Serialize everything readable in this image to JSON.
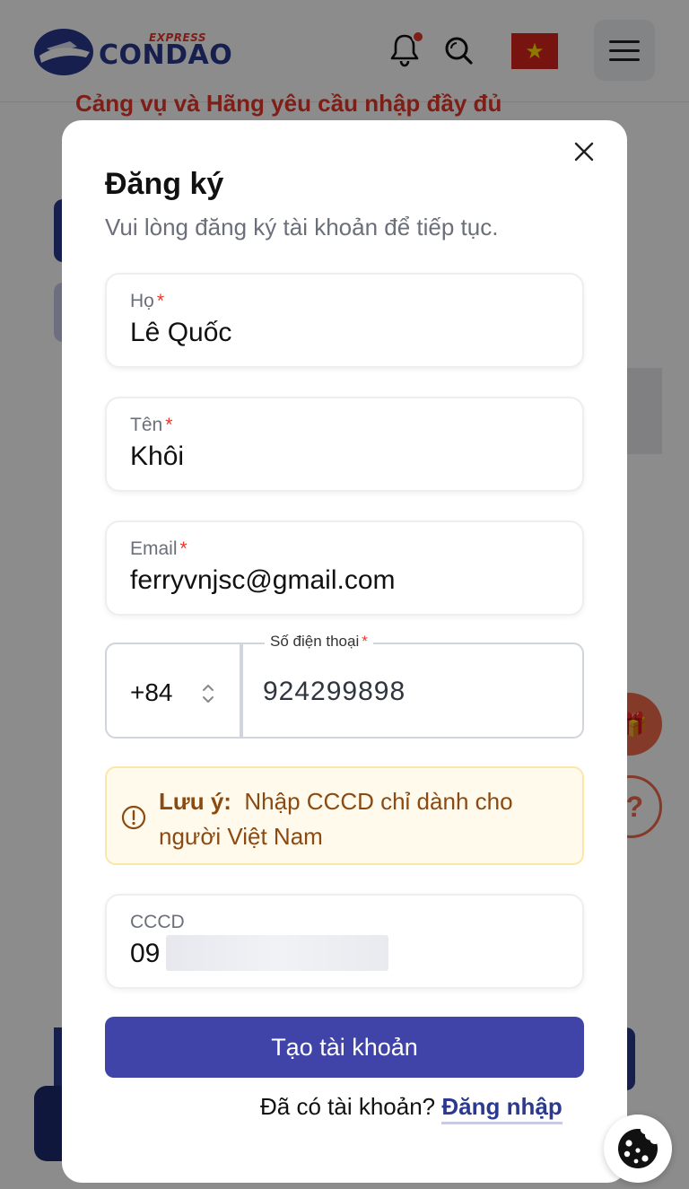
{
  "header": {
    "logo_text": "CONDAO",
    "logo_express": "EXPRESS",
    "flag_icon": "vn-flag-icon",
    "brand_blue": "#2b3a8f",
    "brand_red": "#e5382a"
  },
  "background": {
    "notice_text": "Cảng vụ và Hãng yêu cầu nhập đầy đủ"
  },
  "modal": {
    "title": "Đăng ký",
    "subtitle": "Vui lòng đăng ký tài khoản để tiếp tục.",
    "fields": {
      "last_name": {
        "label": "Họ",
        "required": "*",
        "value": "Lê Quốc"
      },
      "first_name": {
        "label": "Tên",
        "required": "*",
        "value": "Khôi"
      },
      "email": {
        "label": "Email",
        "required": "*",
        "value": "ferryvnjsc@gmail.com"
      },
      "phone": {
        "label": "Số điện thoại",
        "required": "*",
        "country_code": "+84",
        "value": "924299898"
      },
      "cccd": {
        "label": "CCCD",
        "value": "09"
      }
    },
    "note": {
      "title": "Lưu ý:",
      "text": "Nhập CCCD chỉ dành cho người Việt Nam"
    },
    "submit_label": "Tạo tài khoản",
    "login_prompt": "Đã có tài khoản?",
    "login_link": "Đăng nhập",
    "accent_color": "#4044a8"
  }
}
